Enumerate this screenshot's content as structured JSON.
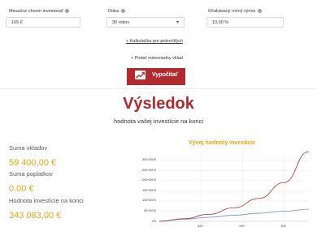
{
  "form": {
    "monthly": {
      "label": "Mesačne chcem investovať",
      "value": "165 €"
    },
    "period": {
      "label": "Doba",
      "value": "30 rokov"
    },
    "expected": {
      "label": "Očakávaný ročný výnos",
      "value": "10,00 %"
    },
    "info_glyph": "i",
    "advanced_link": "+ Kalkulačka pre pokročilých",
    "extra_deposit": "+ Pridať mimoriadny vklad",
    "calc_button": "Vypočítať"
  },
  "result": {
    "title": "Výsledok",
    "subtitle": "hodnota vašej investície na konci",
    "deposits_label": "Suma vkladov",
    "deposits_value": "59 400,00 €",
    "fees_label": "Suma poplatkov",
    "fees_value": "0.00 €",
    "final_label": "Hodnota investície na konci",
    "final_value": "343 083,00 €"
  },
  "colors": {
    "accent": "#b22a2e",
    "value": "#e8a412",
    "deposits_line": "#6f8fcf",
    "value_line": "#b22a2e"
  },
  "chart_data": {
    "type": "line",
    "title": "Vývoj hodnoty investície",
    "y_ticks": [
      "300 000 €",
      "250 000 €",
      "200 000 €",
      "150 000 €",
      "100 000 €",
      "50 000 €",
      "0 €"
    ],
    "x_ticks": [
      "100",
      "200",
      "300"
    ],
    "xlim": [
      0,
      360
    ],
    "ylim": [
      0,
      343083
    ],
    "series": [
      {
        "color": "#6f8fcf",
        "x": [
          0,
          60,
          120,
          180,
          240,
          300,
          360
        ],
        "y": [
          0,
          9900,
          19800,
          29700,
          39600,
          49500,
          59400
        ]
      },
      {
        "color": "#b22a2e",
        "x": [
          0,
          60,
          120,
          180,
          240,
          300,
          360
        ],
        "y": [
          0,
          12870,
          34510,
          66820,
          112800,
          190600,
          343083
        ]
      }
    ]
  }
}
